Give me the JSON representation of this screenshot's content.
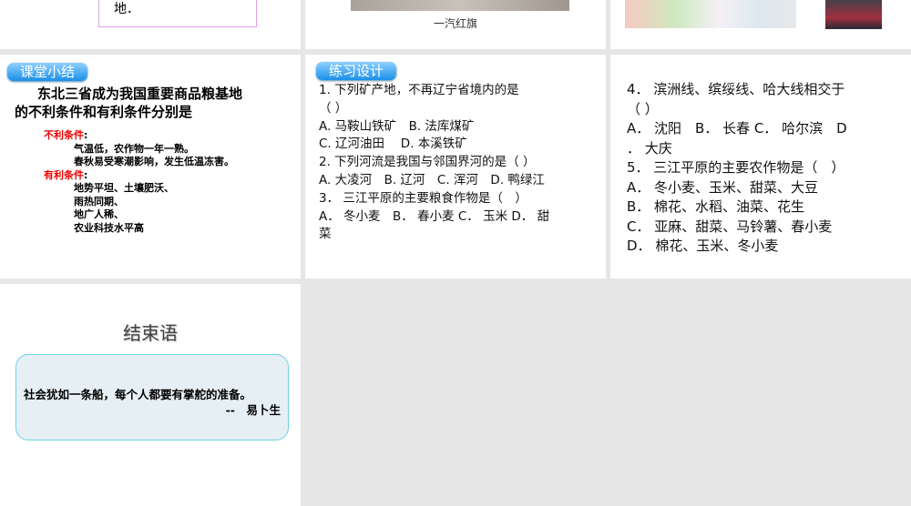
{
  "slides_row1": {
    "slide1_text": "地．",
    "slide2_caption": "一汽红旗"
  },
  "summary": {
    "badge": "课堂小结",
    "title_line1": "东北三省成为我国重要商品粮基地",
    "title_line2": "的不利条件和有利条件分别是",
    "unfavorable_label": "不利条件",
    "unfavorable": [
      "气温低，农作物一年一熟。",
      "春秋易受寒潮影响，发生低温冻害。"
    ],
    "favorable_label": "有利条件",
    "favorable": [
      "地势平坦、土壤肥沃、",
      "雨热同期、",
      "地广人稀、",
      "农业科技水平高"
    ],
    "colon": ":"
  },
  "exercise": {
    "badge": "练习设计",
    "lines": [
      "1. 下列矿产地，不再辽宁省境内的是",
      "（ ）",
      "A. 马鞍山铁矿　B. 法库煤矿",
      " C. 辽河油田　 D. 本溪铁矿",
      "2. 下列河流是我国与邻国界河的是（ ）",
      "A. 大凌河　B. 辽河　C. 浑河　D. 鸭绿江",
      "3． 三江平原的主要粮食作物是（　）",
      "A． 冬小麦　B． 春小麦 C． 玉米 D． 甜",
      "菜"
    ]
  },
  "exercise2": {
    "lines": [
      "4． 滨洲线、缤绥线、哈大线相交于",
      "（ ）",
      "A． 沈阳　B． 长春 C． 哈尔滨　D",
      "． 大庆",
      "5． 三江平原的主要农作物是（　）",
      "A． 冬小麦、玉米、甜菜、大豆",
      "B． 棉花、水稻、油菜、花生",
      "C． 亚麻、甜菜、马铃薯、春小麦",
      "D． 棉花、玉米、冬小麦"
    ]
  },
  "ending": {
    "title": "结束语",
    "quote": "社会犹如一条船，每个人都要有掌舵的准备。",
    "author": "--　易卜生"
  }
}
